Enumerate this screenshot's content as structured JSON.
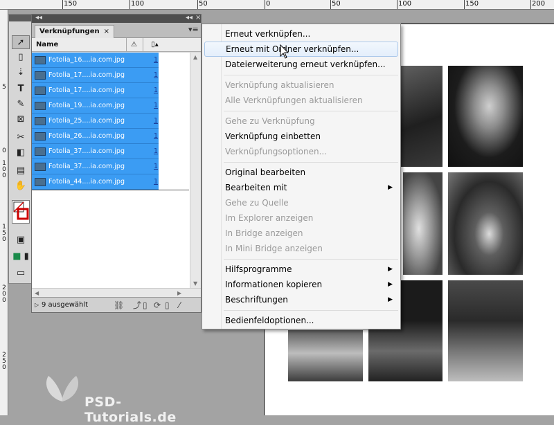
{
  "ruler_top": [
    "150",
    "100",
    "50",
    "0",
    "50",
    "100",
    "150",
    "200"
  ],
  "ruler_left": [
    "5",
    "0",
    "1 0 0",
    "1 5 0",
    "2 0 0",
    "2 5 0"
  ],
  "panel": {
    "tab_label": "Verknüpfungen",
    "tab_close": "×",
    "col_name": "Name",
    "col_status_icon": "warning-icon",
    "col_page_icon": "page-icon",
    "files": [
      {
        "name": "Fotolia_16....ia.com.jpg",
        "page": "1"
      },
      {
        "name": "Fotolia_17....ia.com.jpg",
        "page": "1"
      },
      {
        "name": "Fotolia_17....ia.com.jpg",
        "page": "1"
      },
      {
        "name": "Fotolia_19....ia.com.jpg",
        "page": "1"
      },
      {
        "name": "Fotolia_25....ia.com.jpg",
        "page": "1"
      },
      {
        "name": "Fotolia_26....ia.com.jpg",
        "page": "1"
      },
      {
        "name": "Fotolia_37....ia.com.jpg",
        "page": "1"
      },
      {
        "name": "Fotolia_37....ia.com.jpg",
        "page": "1"
      },
      {
        "name": "Fotolia_44....ia.com.jpg",
        "page": "1"
      }
    ],
    "status": "9 ausgewählt"
  },
  "context_menu": {
    "relink": "Erneut verknüpfen...",
    "relink_folder": "Erneut mit Ordner verknüpfen...",
    "relink_ext": "Dateierweiterung erneut verknüpfen...",
    "update_link": "Verknüpfung aktualisieren",
    "update_all": "Alle Verknüpfungen aktualisieren",
    "goto_link": "Gehe zu Verknüpfung",
    "embed_link": "Verknüpfung einbetten",
    "link_options": "Verknüpfungsoptionen...",
    "edit_original": "Original bearbeiten",
    "edit_with": "Bearbeiten mit",
    "goto_source": "Gehe zu Quelle",
    "show_explorer": "Im Explorer anzeigen",
    "show_bridge": "In Bridge anzeigen",
    "show_mini_bridge": "In Mini Bridge anzeigen",
    "utilities": "Hilfsprogramme",
    "copy_info": "Informationen kopieren",
    "captions": "Beschriftungen",
    "panel_options": "Bedienfeldoptionen..."
  },
  "watermark": "PSD-Tutorials.de",
  "colors": {
    "selection": "#3b9cf3",
    "menu_bg": "#f5f5f5",
    "disabled_text": "#9a9a9a"
  }
}
